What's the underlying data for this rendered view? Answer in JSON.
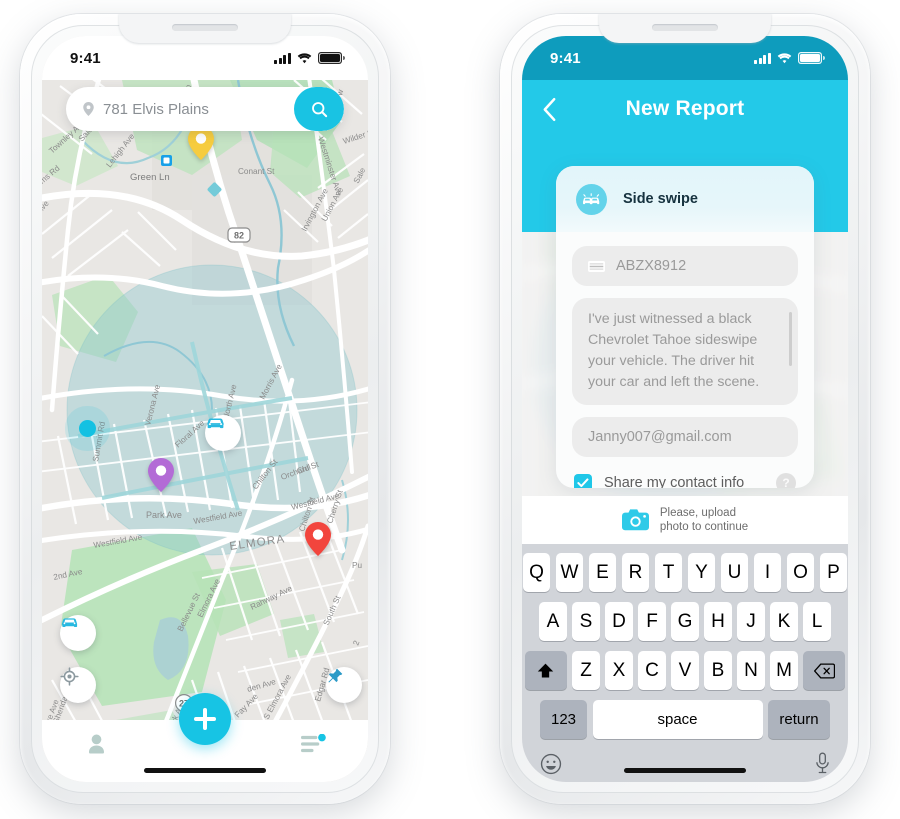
{
  "left_phone": {
    "status": {
      "time": "9:41",
      "signal_icon": "cellular-bars-icon",
      "wifi_icon": "wifi-icon",
      "battery_icon": "battery-full-icon"
    },
    "search": {
      "value": "781 Elvis Plains",
      "placeholder": "Search address",
      "pin_icon": "location-pin-icon",
      "button_icon": "search-icon"
    },
    "map": {
      "labels": [
        "Townley Ave",
        "Salem Rd",
        "Lehigh Ave",
        "Green Ln",
        "rms Rd",
        "Ave",
        "Westminster Ave",
        "Wilder St",
        "Union Ave",
        "Irvington Ave",
        "Conant St",
        "Verona Ave",
        "Summit Rd",
        "Floral Ave",
        "North Ave",
        "Morris Ave",
        "Chilton St",
        "Orchard St",
        "Park Ave",
        "Westfield Ave",
        "Westfield Ave",
        "Cherry St",
        "Chilton St",
        "ELMORA",
        "2nd Ave",
        "Rahway Ave",
        "Elmora Ave",
        "Bellevue St",
        "South St",
        "Dill Ave",
        "Fay Ave",
        "S Elmora Ave",
        "Edgar Rd",
        "Park Ave",
        "Sheridan Ave",
        "Drake Ave",
        "Summ",
        "Ave",
        "den Ave",
        "Pu"
      ],
      "route_shields": [
        "82",
        "27"
      ],
      "markers": [
        {
          "name": "yellow-map-pin",
          "color": "#F6CC3F"
        },
        {
          "name": "purple-map-pin",
          "color": "#B36BD6"
        },
        {
          "name": "red-map-pin",
          "color": "#F2453D"
        },
        {
          "name": "cyan-location-dot",
          "color": "#13C1E2"
        },
        {
          "name": "car-incident-marker",
          "color": "#29B9E0"
        }
      ],
      "controls": [
        {
          "name": "map-car-filter-button",
          "icon": "car-icon"
        },
        {
          "name": "map-locate-me-button",
          "icon": "crosshair-icon"
        },
        {
          "name": "map-pin-drop-button",
          "icon": "pushpin-icon"
        }
      ]
    },
    "tabbar": {
      "items": [
        {
          "name": "tab-profile",
          "icon": "person-icon"
        },
        {
          "name": "tab-add-report",
          "icon": "plus-icon"
        },
        {
          "name": "tab-feed",
          "icon": "list-icon",
          "badge": true
        }
      ]
    }
  },
  "right_phone": {
    "status": {
      "time": "9:41",
      "signal_icon": "cellular-bars-icon",
      "wifi_icon": "wifi-icon",
      "battery_icon": "battery-full-icon"
    },
    "nav": {
      "title": "New Report",
      "back_icon": "chevron-left-icon"
    },
    "card": {
      "category": {
        "label": "Side swipe",
        "icon": "side-swipe-cars-icon"
      },
      "plate": {
        "value": "ABZX8912",
        "icon": "license-plate-icon"
      },
      "description": "I've just witnessed a black Chevrolet Tahoe sideswipe your vehicle. The driver hit your car and left the scene.",
      "email": "Janny007@gmail.com",
      "share_contact": {
        "label": "Share my contact info",
        "checked": true
      },
      "help_label": "?"
    },
    "upload": {
      "line1": "Please, upload",
      "line2": "photo to continue",
      "icon": "camera-icon"
    },
    "keyboard": {
      "row1": [
        "Q",
        "W",
        "E",
        "R",
        "T",
        "Y",
        "U",
        "I",
        "O",
        "P"
      ],
      "row2": [
        "A",
        "S",
        "D",
        "F",
        "G",
        "H",
        "J",
        "K",
        "L"
      ],
      "row3": [
        "Z",
        "X",
        "C",
        "V",
        "B",
        "N",
        "M"
      ],
      "shift_icon": "shift-arrow-icon",
      "backspace_icon": "backspace-icon",
      "numbers_label": "123",
      "space_label": "space",
      "return_label": "return",
      "emoji_icon": "smiley-icon",
      "mic_icon": "microphone-icon"
    }
  },
  "colors": {
    "accent_cyan": "#19C3E3",
    "status_teal": "#0E9CBD",
    "nav_teal": "#23C9E8",
    "card_head": "#E4F6FA",
    "field_gray": "#ECECEC",
    "keyboard_bg": "#D1D4D9"
  }
}
